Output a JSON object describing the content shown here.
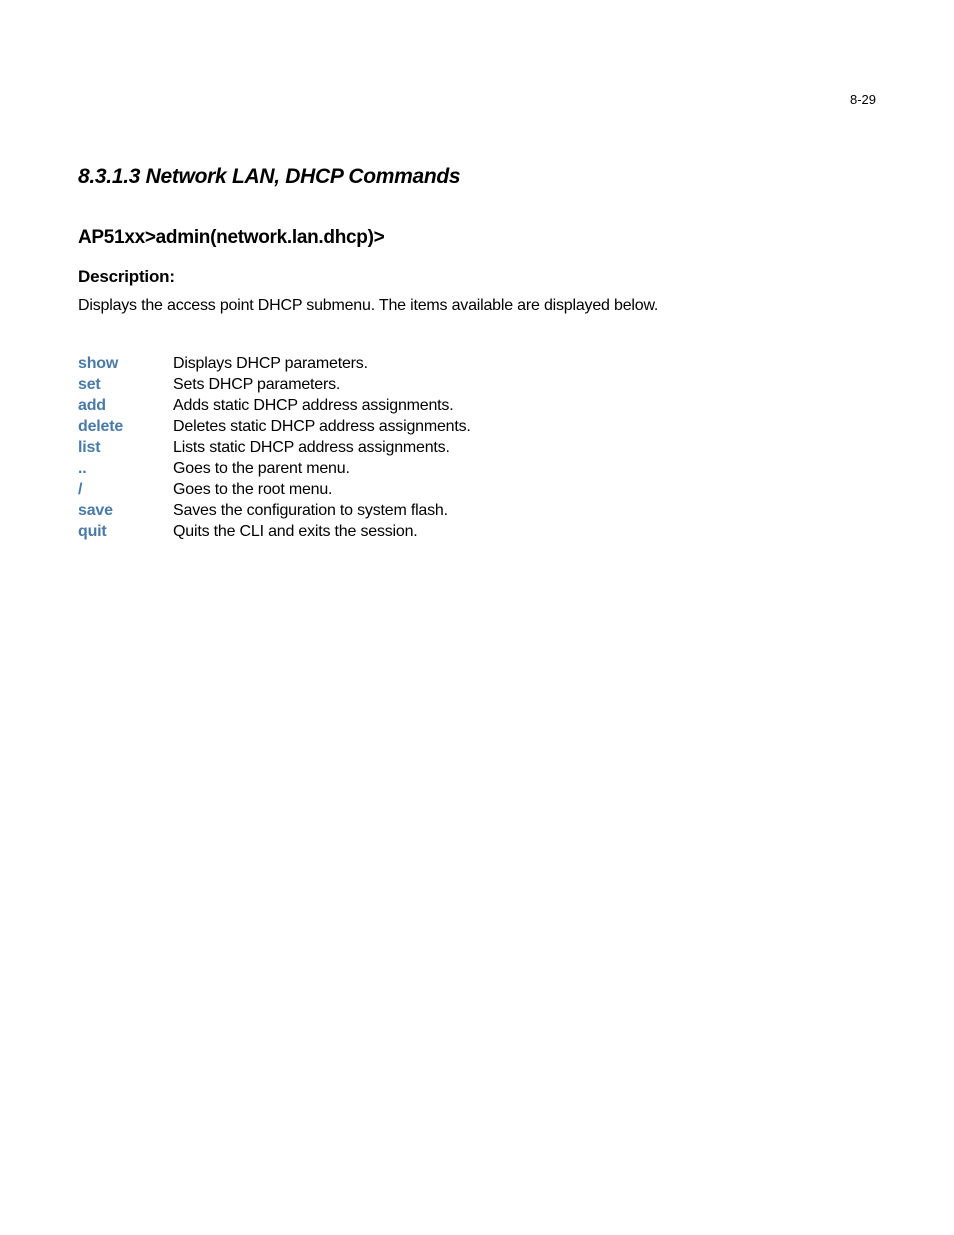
{
  "page_number": "8-29",
  "section_heading": "8.3.1.3  Network LAN, DHCP Commands",
  "prompt_heading": "AP51xx>admin(network.lan.dhcp)>",
  "description_label": "Description:",
  "description_text": "Displays the access point DHCP submenu. The items available are displayed below.",
  "commands": [
    {
      "name": "show",
      "desc": "Displays DHCP parameters."
    },
    {
      "name": "set",
      "desc": "Sets DHCP parameters."
    },
    {
      "name": "add",
      "desc": "Adds static DHCP address assignments."
    },
    {
      "name": "delete",
      "desc": "Deletes static DHCP address assignments."
    },
    {
      "name": "list",
      "desc": "Lists static DHCP address assignments."
    },
    {
      "name": "..",
      "desc": "Goes to the parent menu."
    },
    {
      "name": "/",
      "desc": "Goes to the root menu."
    },
    {
      "name": "save",
      "desc": "Saves the configuration to system flash."
    },
    {
      "name": "quit",
      "desc": "Quits the CLI and exits the session."
    }
  ]
}
